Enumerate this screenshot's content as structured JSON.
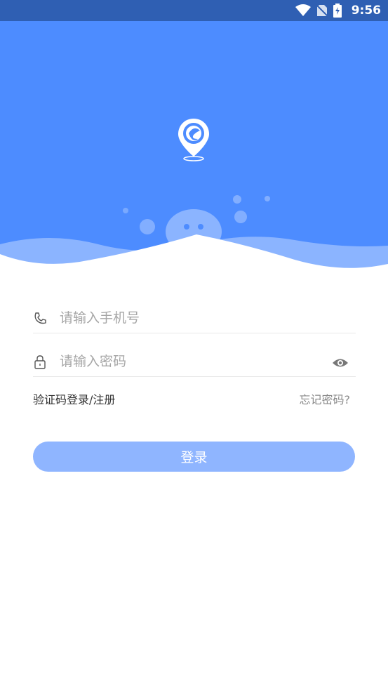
{
  "status_bar": {
    "time": "9:56",
    "icons": [
      "wifi-icon",
      "no-sim-icon",
      "battery-charging-icon"
    ]
  },
  "hero": {
    "logo_icon": "location-pin-logo-icon",
    "colors": {
      "background": "#4d8cff",
      "wave": "#ffffff"
    }
  },
  "form": {
    "phone_placeholder": "请输入手机号",
    "password_placeholder": "请输入密码",
    "phone_icon": "phone-icon",
    "lock_icon": "lock-icon",
    "eye_icon": "eye-icon"
  },
  "links": {
    "sms_login": "验证码登录/注册",
    "forgot_password": "忘记密码?"
  },
  "login_button": {
    "label": "登录",
    "color": "#8fb5ff"
  }
}
